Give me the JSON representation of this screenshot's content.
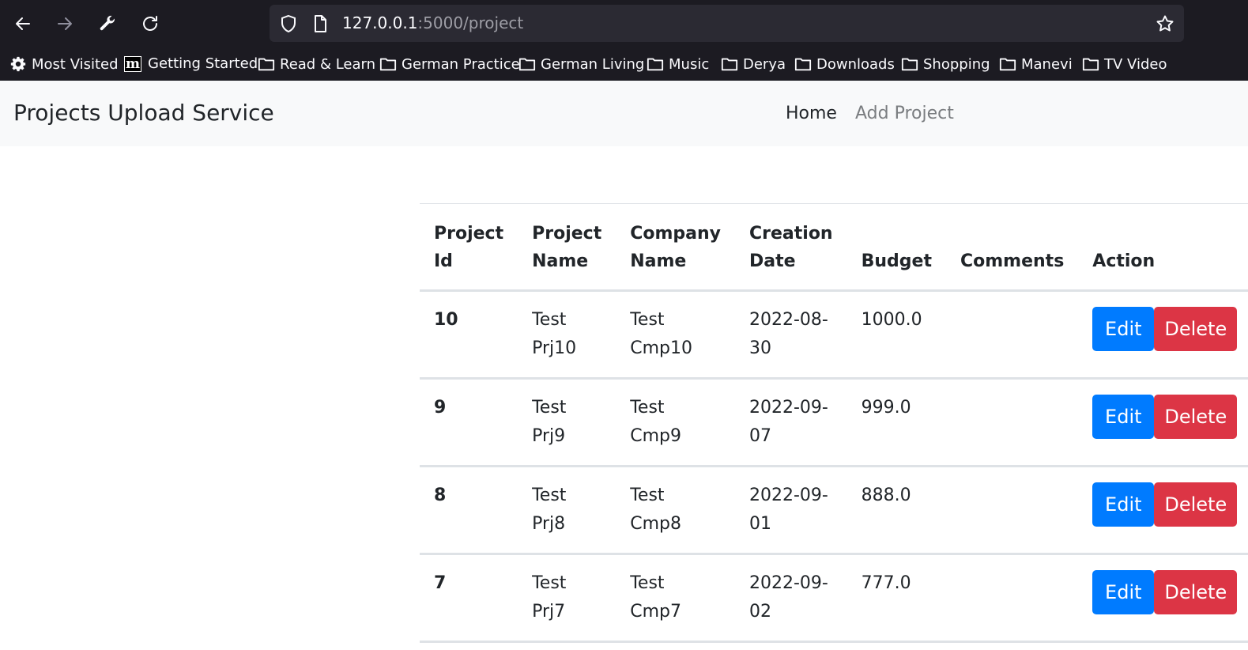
{
  "browser": {
    "url_host": "127.0.0.1",
    "url_path": ":5000/project",
    "bookmarks": [
      {
        "label": "Most Visited",
        "icon": "gear-icon"
      },
      {
        "label": "Getting Started",
        "icon": "m-logo-icon"
      },
      {
        "label": "Read & Learn",
        "icon": "folder-icon"
      },
      {
        "label": "German Practice",
        "icon": "folder-icon"
      },
      {
        "label": "German Living",
        "icon": "folder-icon"
      },
      {
        "label": "Music",
        "icon": "folder-icon"
      },
      {
        "label": "Derya",
        "icon": "folder-icon"
      },
      {
        "label": "Downloads",
        "icon": "folder-icon"
      },
      {
        "label": "Shopping",
        "icon": "folder-icon"
      },
      {
        "label": "Manevi",
        "icon": "folder-icon"
      },
      {
        "label": "TV Video",
        "icon": "folder-icon"
      }
    ],
    "m_logo_letter": "m"
  },
  "navbar": {
    "brand": "Projects Upload Service",
    "links": [
      {
        "label": "Home"
      },
      {
        "label": "Add Project"
      }
    ]
  },
  "table": {
    "headers": {
      "id": [
        "Project",
        "Id"
      ],
      "name": [
        "Project",
        "Name"
      ],
      "company": [
        "Company",
        "Name"
      ],
      "date": [
        "Creation",
        "Date"
      ],
      "budget": "Budget",
      "comments": "Comments",
      "action": "Action"
    },
    "rows": [
      {
        "id": "10",
        "name": [
          "Test",
          "Prj10"
        ],
        "company": [
          "Test",
          "Cmp10"
        ],
        "date": "2022-08-30",
        "budget": "1000.0",
        "comments": ""
      },
      {
        "id": "9",
        "name": [
          "Test",
          "Prj9"
        ],
        "company": [
          "Test",
          "Cmp9"
        ],
        "date": "2022-09-07",
        "budget": "999.0",
        "comments": ""
      },
      {
        "id": "8",
        "name": [
          "Test",
          "Prj8"
        ],
        "company": [
          "Test",
          "Cmp8"
        ],
        "date": "2022-09-01",
        "budget": "888.0",
        "comments": ""
      },
      {
        "id": "7",
        "name": [
          "Test",
          "Prj7"
        ],
        "company": [
          "Test",
          "Cmp7"
        ],
        "date": "2022-09-02",
        "budget": "777.0",
        "comments": ""
      }
    ],
    "edit_label": "Edit",
    "delete_label": "Delete"
  },
  "colors": {
    "edit_button": "#007bff",
    "delete_button": "#dc3545",
    "navbar_bg": "#f8f9fa",
    "chrome_bg": "#1c1b22"
  }
}
